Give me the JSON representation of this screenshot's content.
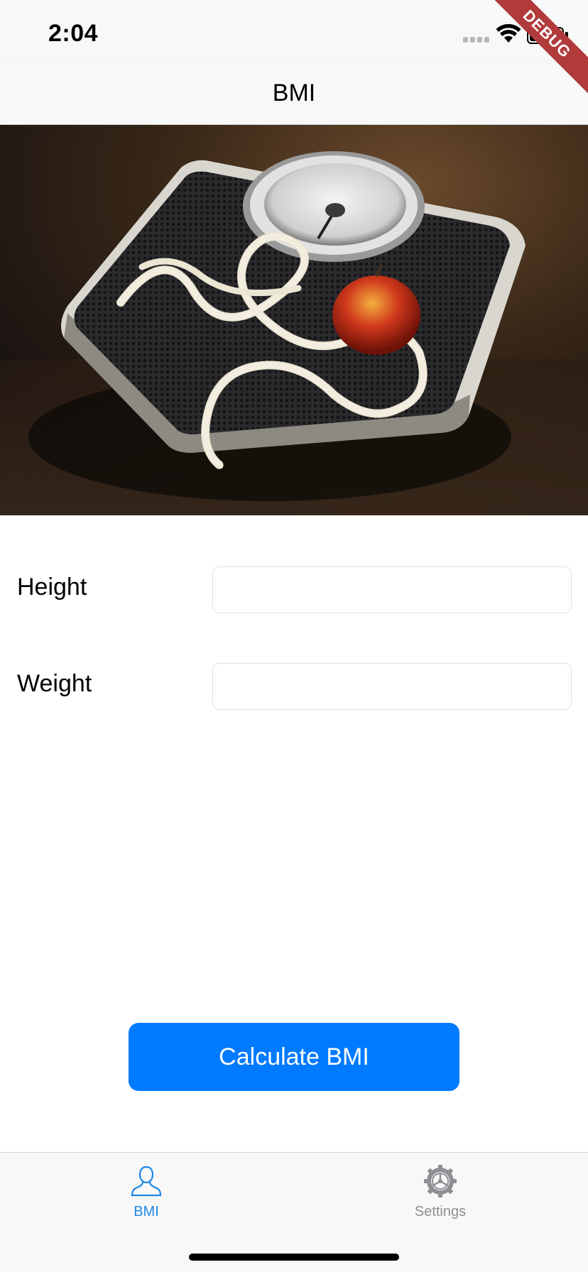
{
  "status_bar": {
    "time": "2:04"
  },
  "debug_banner": "DEBUG",
  "nav": {
    "title": "BMI"
  },
  "hero_image": {
    "name": "scale-with-apple-and-tape"
  },
  "form": {
    "height_label": "Height",
    "height_value": "",
    "weight_label": "Weight",
    "weight_value": ""
  },
  "actions": {
    "calculate_label": "Calculate BMI"
  },
  "tab_bar": {
    "items": [
      {
        "label": "BMI",
        "icon": "person-icon",
        "active": true
      },
      {
        "label": "Settings",
        "icon": "gear-icon",
        "active": false
      }
    ]
  },
  "colors": {
    "accent": "#007aff",
    "tab_active": "#1e88e5",
    "tab_inactive": "#8e8e93",
    "debug": "#b13b3b"
  }
}
